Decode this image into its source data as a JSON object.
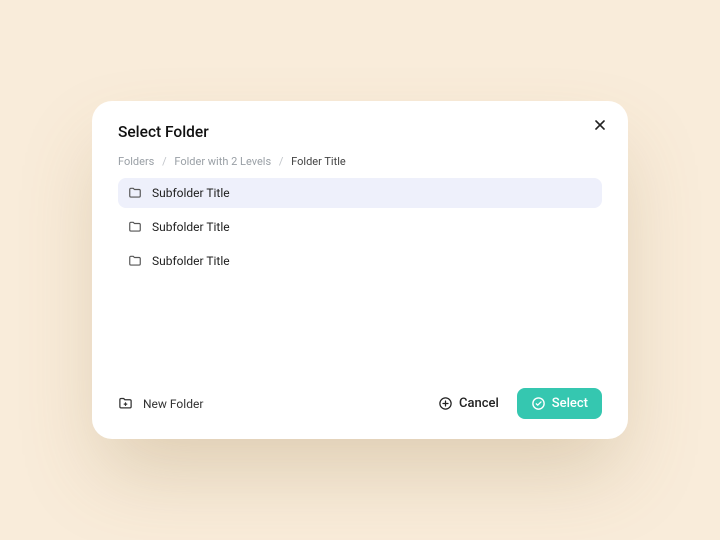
{
  "modal": {
    "title": "Select Folder",
    "close_icon_label": "×"
  },
  "breadcrumb": {
    "items": [
      "Folders",
      "Folder with 2 Levels",
      "Folder Title"
    ],
    "separator": "/"
  },
  "folders": [
    {
      "label": "Subfolder Title",
      "selected": true
    },
    {
      "label": "Subfolder Title",
      "selected": false
    },
    {
      "label": "Subfolder Title",
      "selected": false
    }
  ],
  "footer": {
    "new_folder_label": "New Folder",
    "cancel_label": "Cancel",
    "select_label": "Select"
  },
  "colors": {
    "accent": "#35c7b0",
    "selected_row_bg": "#eef0fb",
    "page_bg": "#f9ecda"
  }
}
